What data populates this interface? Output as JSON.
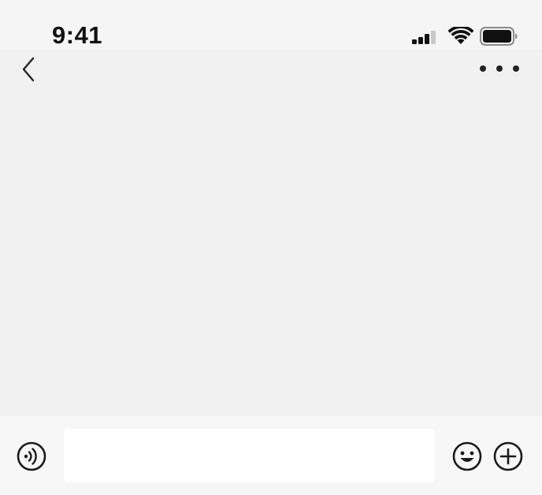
{
  "status_bar": {
    "time": "9:41",
    "signal_icon": "cellular-signal-icon",
    "wifi_icon": "wifi-icon",
    "battery_icon": "battery-icon"
  },
  "nav_bar": {
    "back_icon": "chevron-left-icon",
    "more_icon": "more-dots-icon"
  },
  "chat": {
    "messages": []
  },
  "input_bar": {
    "voice_icon": "voice-icon",
    "input_value": "",
    "input_placeholder": "",
    "emoji_icon": "emoji-icon",
    "plus_icon": "plus-circle-icon"
  },
  "colors": {
    "background": "#f1f1f1",
    "input_bar_background": "#f7f7f7",
    "input_background": "#ffffff",
    "icon": "#111111"
  }
}
